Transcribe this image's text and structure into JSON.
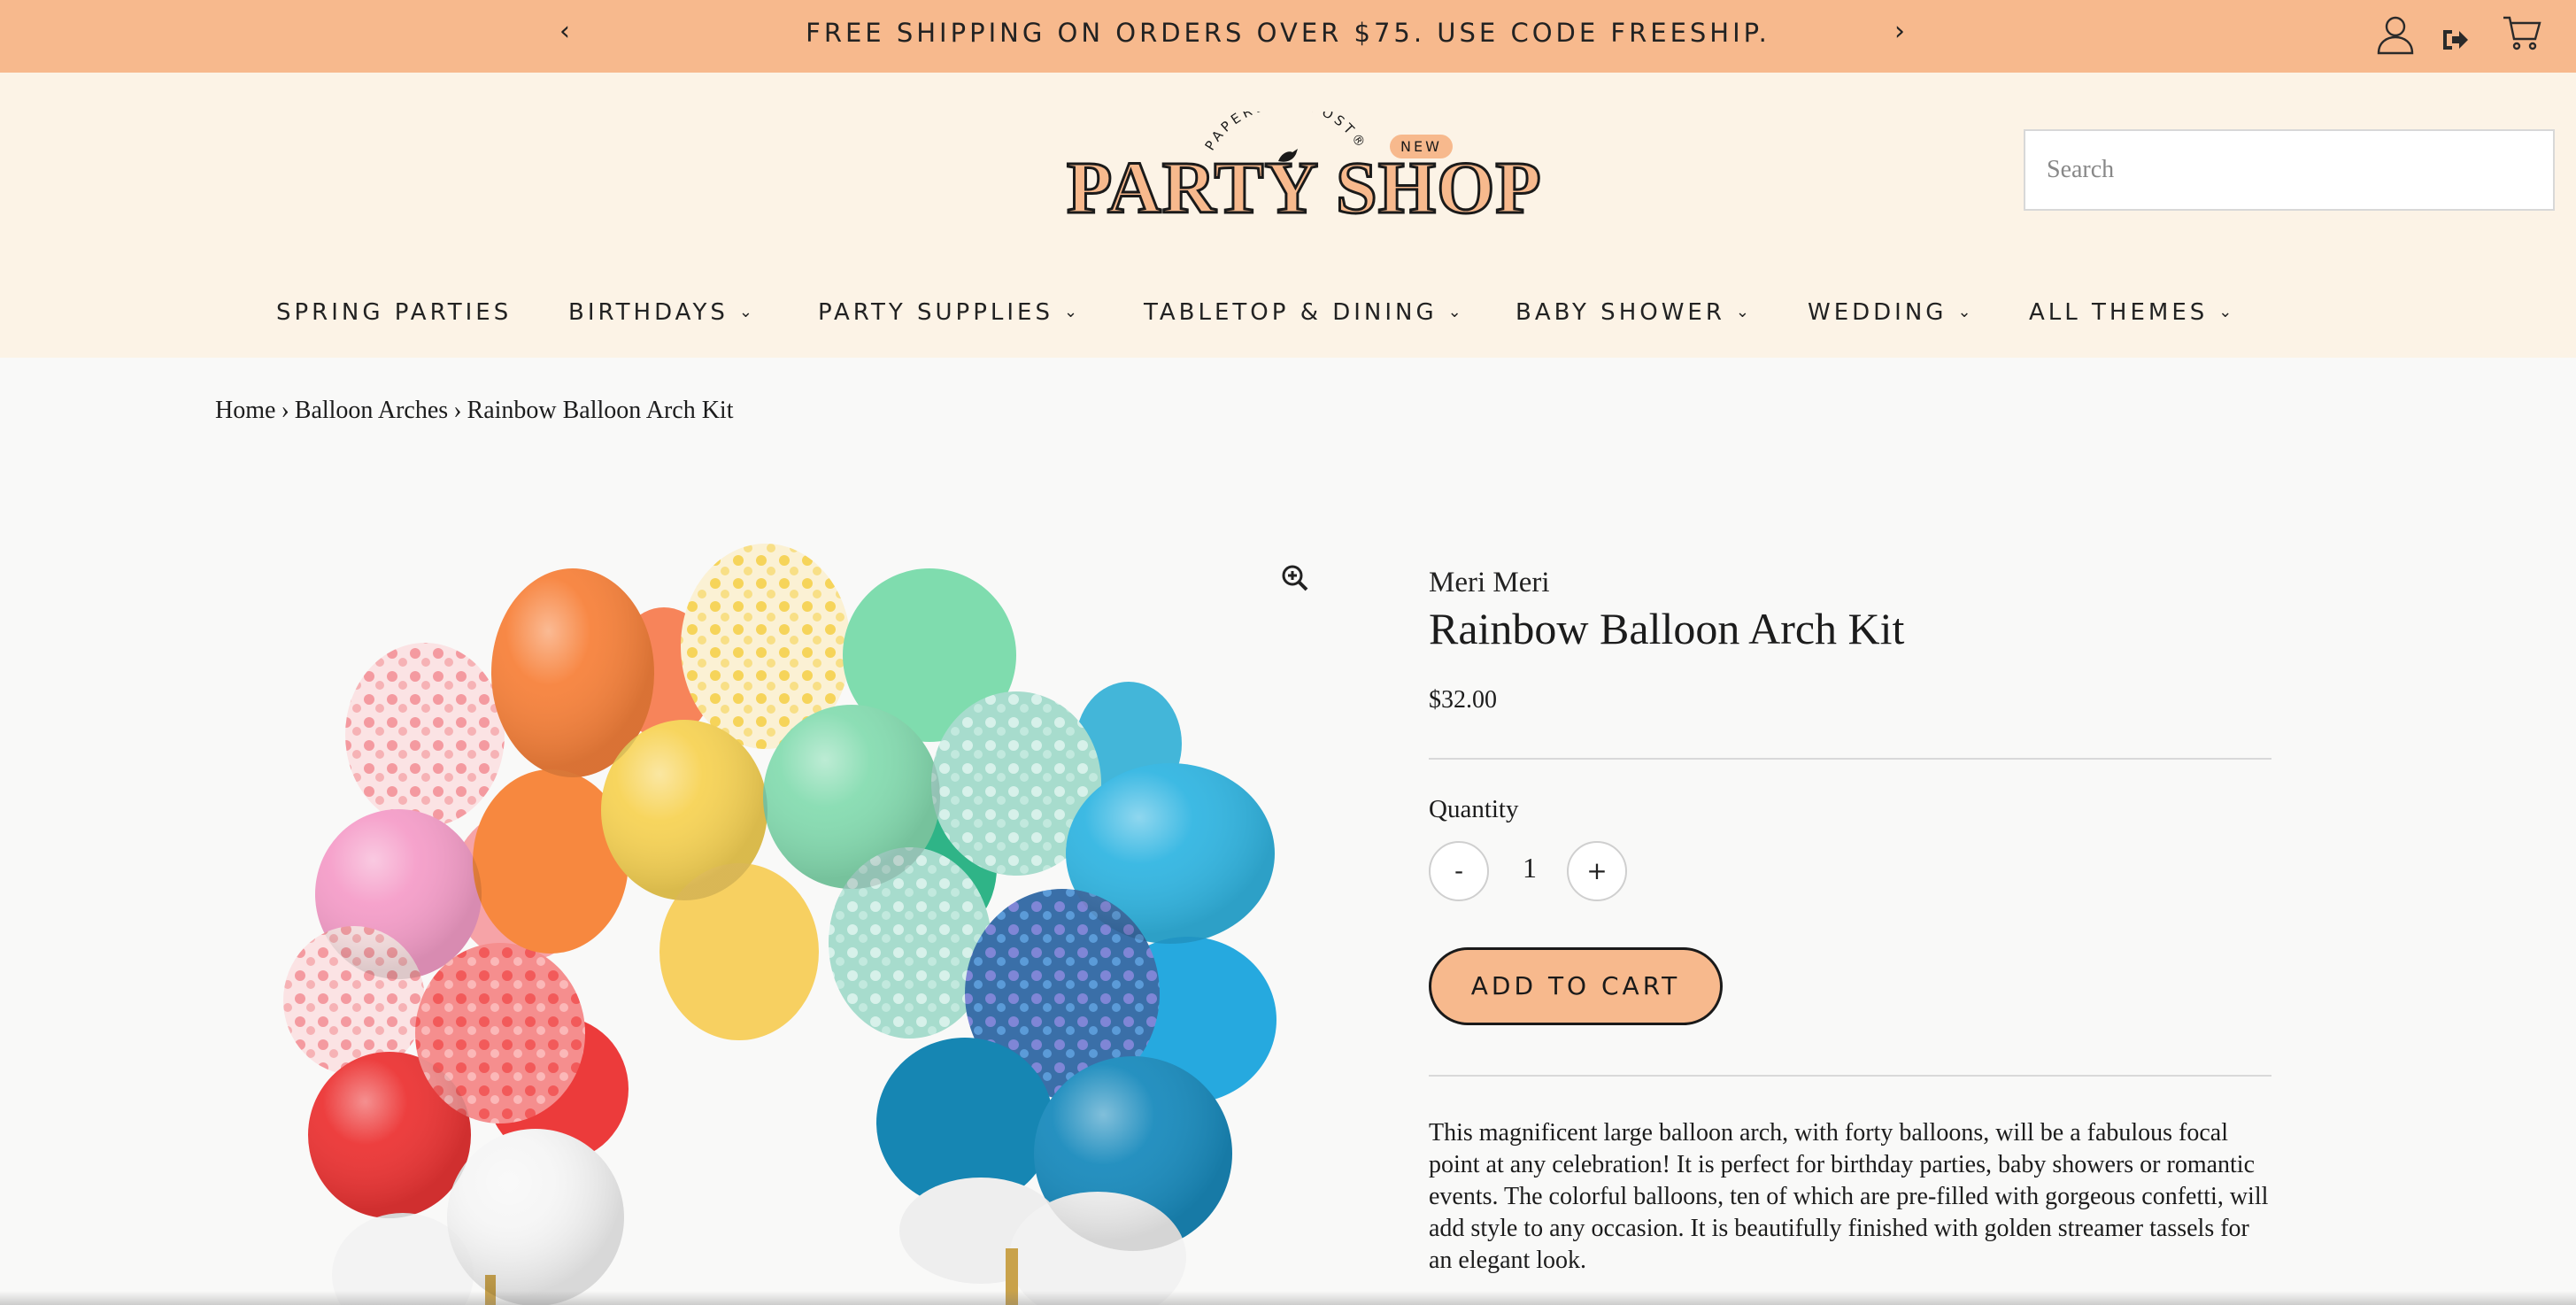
{
  "announcement": {
    "prev_icon": "‹",
    "next_icon": "›",
    "message": "FREE SHIPPING ON ORDERS OVER $75. USE CODE FREESHIP."
  },
  "utility_icons": [
    "account-icon",
    "logout-icon",
    "cart-icon"
  ],
  "logo": {
    "top_text": "PAPERLESS POST®",
    "main_text": "PARTY SHOP",
    "badge": "NEW"
  },
  "search": {
    "placeholder": "Search"
  },
  "nav": {
    "items": [
      {
        "label": "SPRING PARTIES",
        "has_dropdown": false
      },
      {
        "label": "BIRTHDAYS",
        "has_dropdown": true
      },
      {
        "label": "PARTY SUPPLIES",
        "has_dropdown": true
      },
      {
        "label": "TABLETOP & DINING",
        "has_dropdown": true
      },
      {
        "label": "BABY SHOWER",
        "has_dropdown": true
      },
      {
        "label": "WEDDING",
        "has_dropdown": true
      },
      {
        "label": "ALL THEMES",
        "has_dropdown": true
      }
    ],
    "chevron": "⌄"
  },
  "breadcrumb": {
    "items": [
      "Home",
      "Balloon Arches",
      "Rainbow Balloon Arch Kit"
    ],
    "separator": "›"
  },
  "product": {
    "vendor": "Meri Meri",
    "title": "Rainbow Balloon Arch Kit",
    "price": "$32.00",
    "quantity_label": "Quantity",
    "quantity_minus": "-",
    "quantity_value": "1",
    "quantity_plus": "+",
    "add_to_cart": "ADD TO CART",
    "description": "This magnificent large balloon arch, with forty balloons, will be a fabulous focal point at any celebration! It is perfect for birthday parties, baby showers or romantic events. The colorful balloons, ten of which are pre-filled with gorgeous confetti, will add style to any occasion. It is beautifully finished with golden streamer tassels for an elegant look."
  },
  "colors": {
    "accent_peach": "#f7b98d",
    "header_bg": "#fcf3e6",
    "page_bg": "#f9f9f8",
    "text": "#1c1c1c"
  }
}
